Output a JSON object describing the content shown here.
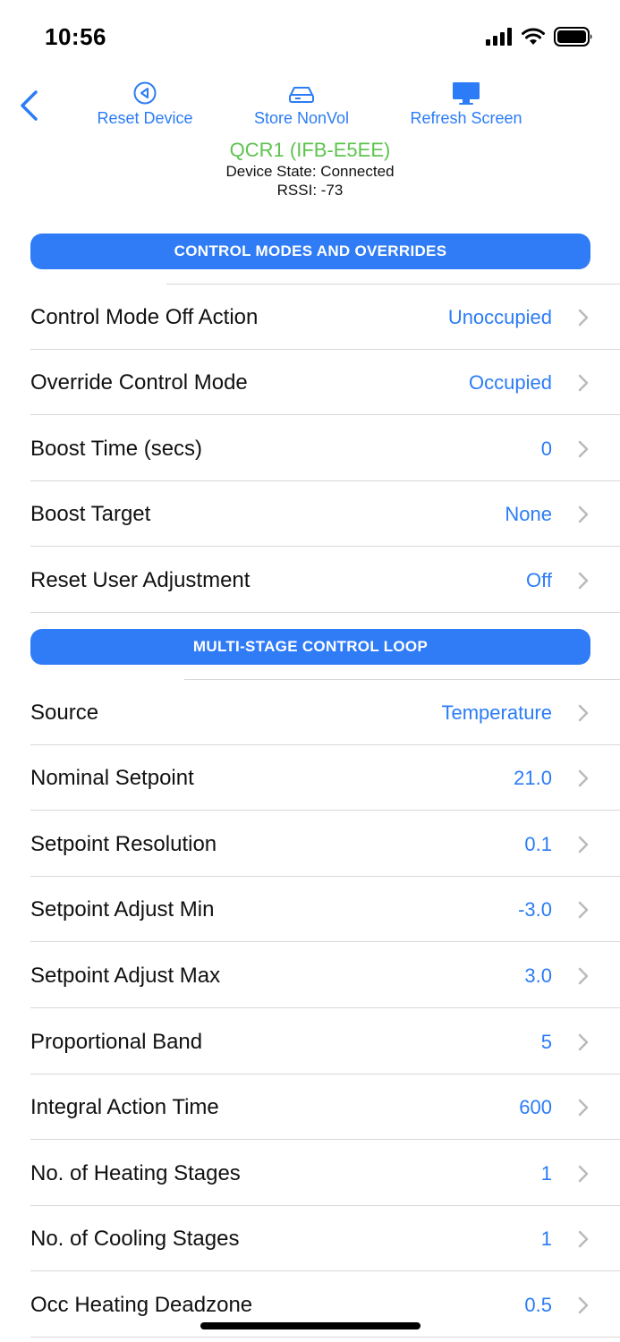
{
  "status_bar": {
    "time": "10:56"
  },
  "toolbar": {
    "reset_label": "Reset Device",
    "store_label": "Store NonVol",
    "refresh_label": "Refresh Screen"
  },
  "device": {
    "name": "QCR1 (IFB-E5EE)",
    "state": "Device State: Connected",
    "rssi": "RSSI: -73"
  },
  "sections": {
    "control": {
      "title": "CONTROL MODES AND OVERRIDES",
      "rows": [
        {
          "label": "Control Mode Off Action",
          "value": "Unoccupied"
        },
        {
          "label": "Override Control Mode",
          "value": "Occupied"
        },
        {
          "label": "Boost Time (secs)",
          "value": "0"
        },
        {
          "label": "Boost Target",
          "value": "None"
        },
        {
          "label": "Reset User Adjustment",
          "value": "Off"
        }
      ]
    },
    "multistage": {
      "title": "MULTI-STAGE CONTROL LOOP",
      "rows": [
        {
          "label": "Source",
          "value": "Temperature"
        },
        {
          "label": "Nominal Setpoint",
          "value": "21.0"
        },
        {
          "label": "Setpoint Resolution",
          "value": "0.1"
        },
        {
          "label": "Setpoint Adjust Min",
          "value": "-3.0"
        },
        {
          "label": "Setpoint Adjust Max",
          "value": "3.0"
        },
        {
          "label": "Proportional Band",
          "value": "5"
        },
        {
          "label": "Integral Action Time",
          "value": "600"
        },
        {
          "label": "No. of Heating Stages",
          "value": "1"
        },
        {
          "label": "No. of Cooling Stages",
          "value": "1"
        },
        {
          "label": "Occ Heating Deadzone",
          "value": "0.5"
        }
      ]
    }
  },
  "colors": {
    "accent": "#2b7cf6",
    "section_bg": "#2f7cf6",
    "device_name": "#5ec34f"
  },
  "icons": {
    "back": "chevron-left-icon",
    "reset": "play-back-circle-icon",
    "store": "storage-drive-icon",
    "refresh": "monitor-icon"
  }
}
